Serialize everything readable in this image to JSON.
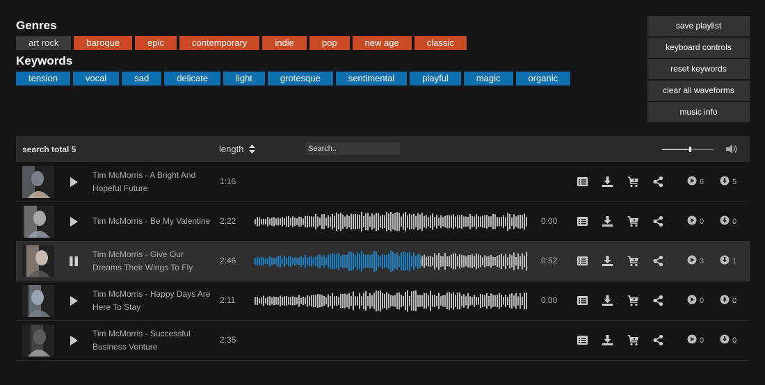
{
  "genres": {
    "title": "Genres",
    "tags": [
      {
        "label": "art rock",
        "active": true
      },
      {
        "label": "baroque",
        "active": false
      },
      {
        "label": "epic",
        "active": false
      },
      {
        "label": "contemporary",
        "active": false
      },
      {
        "label": "indie",
        "active": false
      },
      {
        "label": "pop",
        "active": false
      },
      {
        "label": "new age",
        "active": false
      },
      {
        "label": "classic",
        "active": false
      }
    ]
  },
  "keywords": {
    "title": "Keywords",
    "tags": [
      "tension",
      "vocal",
      "sad",
      "delicate",
      "light",
      "grotesque",
      "sentimental",
      "playful",
      "magic",
      "organic"
    ]
  },
  "side_buttons": [
    "save playlist",
    "keyboard controls",
    "reset keywords",
    "clear all waveforms",
    "music info"
  ],
  "list_header": {
    "search_total": "search total 5",
    "length_label": "length",
    "search_placeholder": "Search.."
  },
  "volume": 0.55,
  "colors": {
    "genre_tag": "#c94a25",
    "genre_active": "#3a3a3a",
    "keyword_tag": "#0e6fae",
    "wave_played": "#1a80c4",
    "wave_unplayed": "#bbbbbb"
  },
  "tracks": [
    {
      "title": "Tim McMorris - A Bright And Hopeful Future",
      "length": "1:16",
      "waveform": false,
      "time": "",
      "played": 0,
      "plays": "6",
      "downloads": "5",
      "state": "play"
    },
    {
      "title": "Tim McMorris - Be My Valentine",
      "length": "2:22",
      "waveform": true,
      "time": "0:00",
      "played": 0,
      "plays": "0",
      "downloads": "0",
      "state": "play"
    },
    {
      "title": "Tim McMorris - Give Our Dreams Their Wings To Fly",
      "length": "2:46",
      "waveform": true,
      "time": "0:52",
      "played": 0.61,
      "plays": "3",
      "downloads": "1",
      "state": "pause"
    },
    {
      "title": "Tim McMorris - Happy Days Are Here To Stay",
      "length": "2:11",
      "waveform": true,
      "time": "0:00",
      "played": 0,
      "plays": "0",
      "downloads": "0",
      "state": "play"
    },
    {
      "title": "Tim McMorris - Successful Business Venture",
      "length": "2:35",
      "waveform": false,
      "time": "",
      "played": 0,
      "plays": "0",
      "downloads": "0",
      "state": "play"
    }
  ]
}
